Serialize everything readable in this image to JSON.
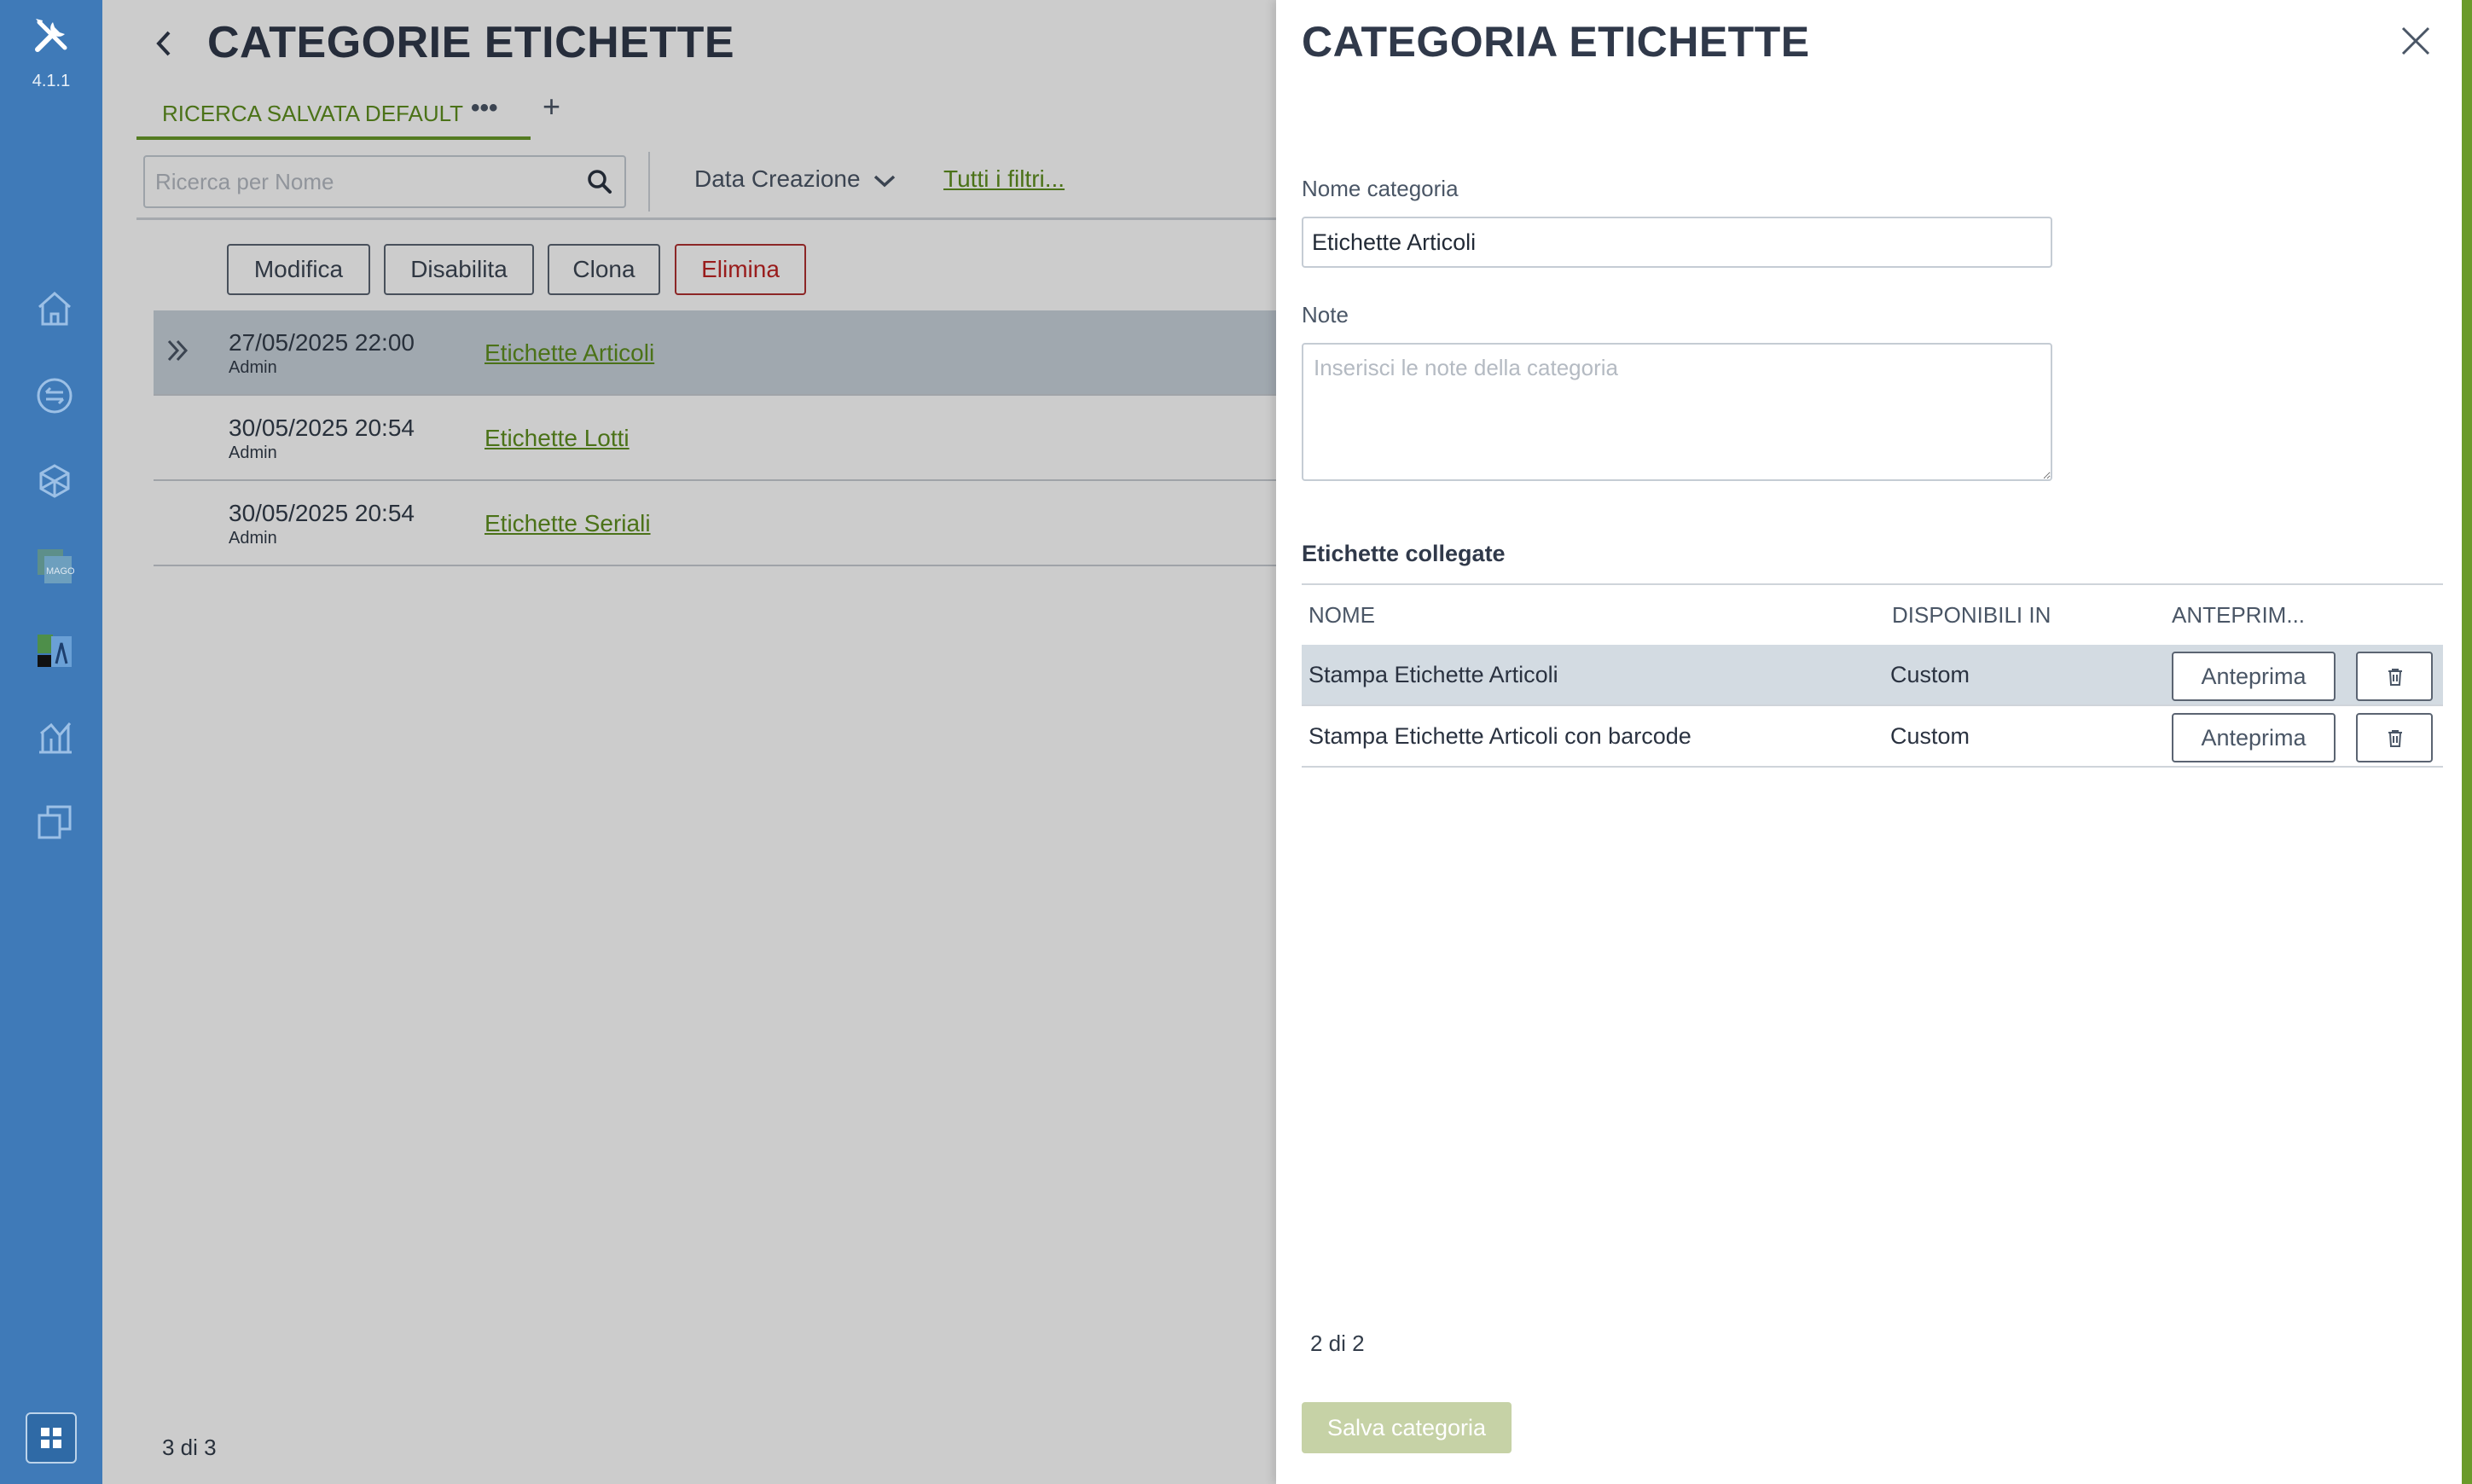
{
  "app": {
    "version": "4.1.1"
  },
  "nav": {
    "items": [
      {
        "icon": "home-icon"
      },
      {
        "icon": "transfer-icon"
      },
      {
        "icon": "cube-icon"
      },
      {
        "icon": "mago-icon",
        "label": "MAGO"
      },
      {
        "icon": "app-icon"
      },
      {
        "icon": "chart-icon"
      },
      {
        "icon": "copy-icon"
      }
    ],
    "bottom_icon": "apps-grid-icon"
  },
  "list": {
    "title": "CATEGORIE ETICHETTE",
    "saved_search_tab": "RICERCA SALVATA DEFAULT",
    "tab_more": "•••",
    "add_tab": "+",
    "search": {
      "placeholder": "Ricerca per Nome",
      "value": ""
    },
    "sort": "Data Creazione",
    "all_filters": "Tutti i filtri...",
    "actions": {
      "edit": "Modifica",
      "disable": "Disabilita",
      "clone": "Clona",
      "delete": "Elimina"
    },
    "rows": [
      {
        "date": "27/05/2025 22:00",
        "user": "Admin",
        "name": "Etichette Articoli",
        "selected": true
      },
      {
        "date": "30/05/2025 20:54",
        "user": "Admin",
        "name": "Etichette Lotti",
        "selected": false
      },
      {
        "date": "30/05/2025 20:54",
        "user": "Admin",
        "name": "Etichette Seriali",
        "selected": false
      }
    ],
    "count": "3 di 3"
  },
  "panel": {
    "title": "CATEGORIA ETICHETTE",
    "name_label": "Nome categoria",
    "name_value": "Etichette Articoli",
    "notes_label": "Note",
    "notes_placeholder": "Inserisci le note della categoria",
    "notes_value": "",
    "linked_title": "Etichette collegate",
    "columns": {
      "name": "NOME",
      "available": "DISPONIBILI IN",
      "preview": "ANTEPRIM..."
    },
    "linked": [
      {
        "name": "Stampa Etichette Articoli",
        "available": "Custom",
        "preview_label": "Anteprima"
      },
      {
        "name": "Stampa Etichette Articoli con barcode",
        "available": "Custom",
        "preview_label": "Anteprima"
      }
    ],
    "count": "2 di 2",
    "save_label": "Salva categoria"
  },
  "colors": {
    "nav_bg": "#3f7ab8",
    "accent_green": "#5e8f1f",
    "danger": "#c02424",
    "title_text": "#30394a",
    "save_disabled": "#c6d2a6"
  }
}
